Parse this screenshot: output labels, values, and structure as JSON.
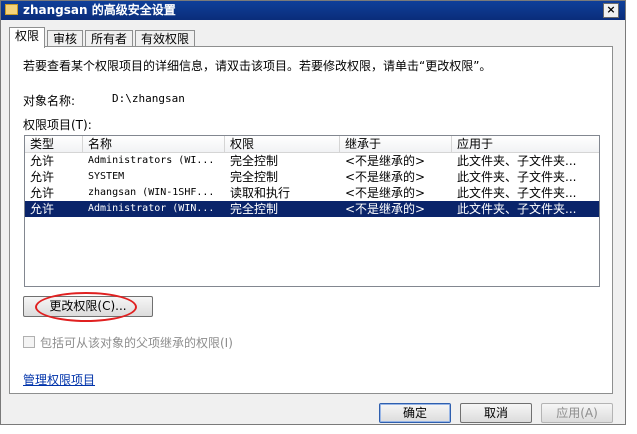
{
  "window": {
    "title": "zhangsan 的高级安全设置",
    "close_glyph": "×"
  },
  "tabs": [
    {
      "label": "权限"
    },
    {
      "label": "审核"
    },
    {
      "label": "所有者"
    },
    {
      "label": "有效权限"
    }
  ],
  "panel": {
    "description": "若要查看某个权限项目的详细信息，请双击该项目。若要修改权限，请单击“更改权限”。",
    "object_name_label": "对象名称:",
    "object_name_value": "D:\\zhangsan",
    "entries_label": "权限项目(T):",
    "columns": [
      "类型",
      "名称",
      "权限",
      "继承于",
      "应用于"
    ],
    "rows": [
      {
        "type": "允许",
        "name": "Administrators (WI...",
        "permission": "完全控制",
        "inherited_from": "<不是继承的>",
        "applies_to": "此文件夹、子文件夹..."
      },
      {
        "type": "允许",
        "name": "SYSTEM",
        "permission": "完全控制",
        "inherited_from": "<不是继承的>",
        "applies_to": "此文件夹、子文件夹..."
      },
      {
        "type": "允许",
        "name": "zhangsan (WIN-1SHF...",
        "permission": "读取和执行",
        "inherited_from": "<不是继承的>",
        "applies_to": "此文件夹、子文件夹..."
      },
      {
        "type": "允许",
        "name": "Administrator (WIN...",
        "permission": "完全控制",
        "inherited_from": "<不是继承的>",
        "applies_to": "此文件夹、子文件夹..."
      }
    ],
    "change_button": "更改权限(C)...",
    "inherit_checkbox_label": "包括可从该对象的父项继承的权限(I)",
    "manage_link": "管理权限项目"
  },
  "buttons": {
    "ok": "确定",
    "cancel": "取消",
    "apply": "应用(A)"
  },
  "colors": {
    "title_bar": "#0a2d7a",
    "selection": "#0a246a",
    "highlight_ellipse": "#e02020",
    "link": "#0033aa"
  }
}
